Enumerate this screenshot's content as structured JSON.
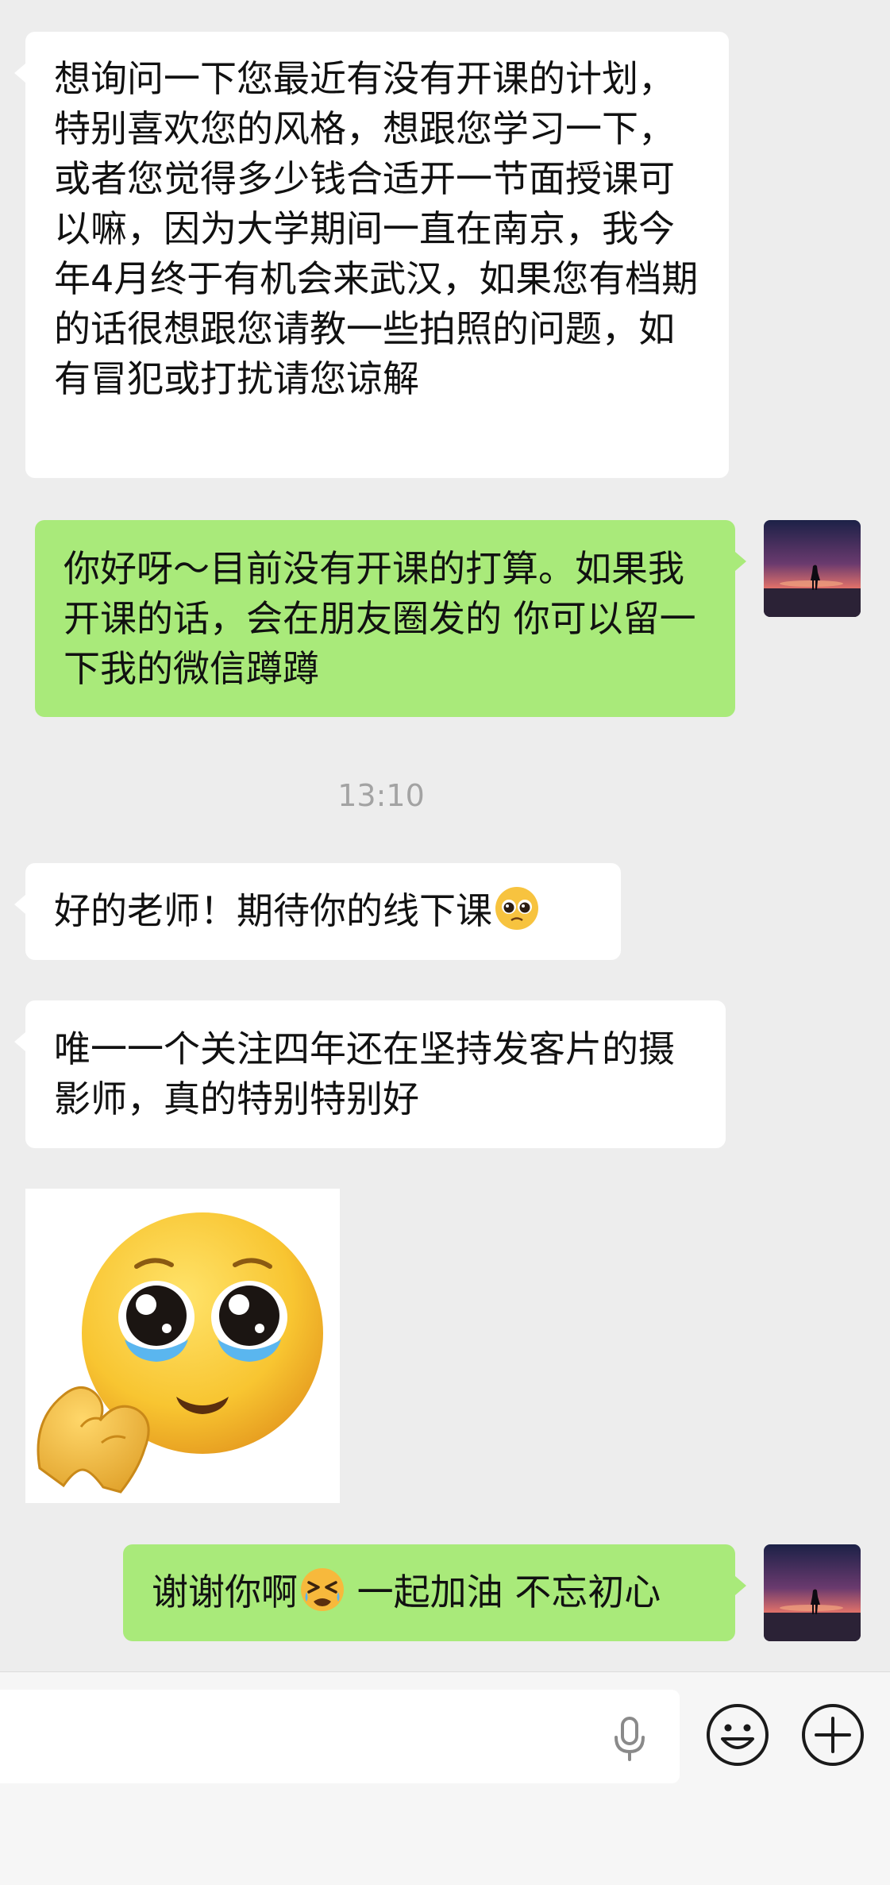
{
  "messages": [
    {
      "from": "contact",
      "text": "想询问一下您最近有没有开课的计划，特别喜欢您的风格，想跟您学习一下，或者您觉得多少钱合适开一节面授课可以嘛，因为大学期间一直在南京，我今年4月终于有机会来武汉，如果您有档期的话很想跟您请教一些拍照的问题，如有冒犯或打扰请您谅解"
    },
    {
      "from": "me",
      "text": "你好呀～目前没有开课的打算。如果我开课的话，会在朋友圈发的 你可以留一下我的微信蹲蹲"
    },
    {
      "from": "contact",
      "text": "好的老师！期待你的线下课"
    },
    {
      "from": "contact",
      "text": "唯一一个关注四年还在坚持发客片的摄影师，真的特别特别好"
    },
    {
      "from": "me",
      "text_before_emoji": "谢谢你啊",
      "text_after_emoji": " 一起加油 不忘初心"
    }
  ],
  "timestamp": "13:10",
  "sticker": {
    "icon": "pleading-face-heart-hands-sticker"
  },
  "inline_emojis": [
    "pleading-face-emoji",
    "persevering-face-emoji"
  ],
  "input_bar": {
    "voice_icon": "microphone-icon",
    "emoji_button_icon": "smiley-face-icon",
    "more_button_icon": "plus-circle-icon"
  },
  "colors": {
    "background": "#ededed",
    "incoming_bubble": "#ffffff",
    "outgoing_bubble": "#a9ea7a",
    "timestamp_text": "#a3a3a3"
  }
}
